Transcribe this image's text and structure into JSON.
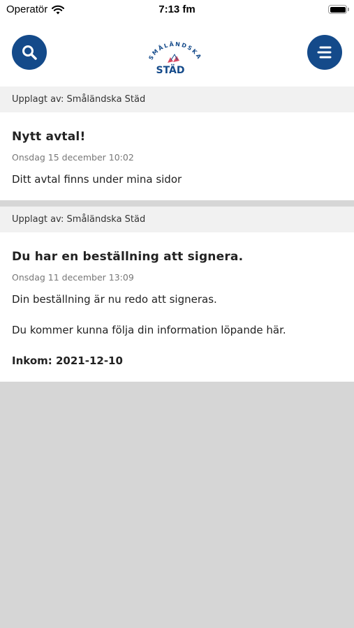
{
  "status_bar": {
    "carrier": "Operatör",
    "time": "7:13 fm"
  },
  "header": {
    "search_icon": "search-icon",
    "menu_icon": "hamburger-menu-icon",
    "logo_top": "SMÅLÄNDSKA",
    "logo_bottom": "STÄD",
    "brand_color": "#144a8a"
  },
  "posts": [
    {
      "meta": "Upplagt av: Småländska Städ",
      "title": "Nytt avtal!",
      "date": "Onsdag 15 december 10:02",
      "text1": "Ditt avtal finns under mina sidor"
    },
    {
      "meta": "Upplagt av: Småländska Städ",
      "title": "Du har en beställning att signera.",
      "date": "Onsdag 11 december 13:09",
      "text1": "Din beställning är nu redo att signeras.",
      "text2": "Du kommer kunna följa din information löpande här.",
      "text3": "Inkom: 2021-12-10"
    }
  ]
}
